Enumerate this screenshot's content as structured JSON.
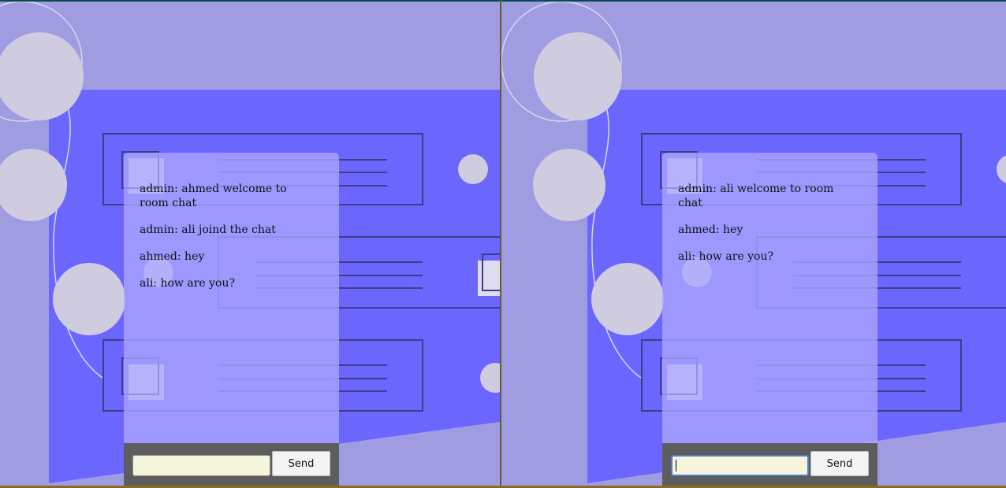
{
  "windows": [
    {
      "messages": [
        "admin: ahmed welcome to room chat",
        "admin: ali joind the chat",
        "ahmed: hey",
        "ali: how are you?"
      ],
      "input": {
        "value": "",
        "focused": false
      },
      "send_label": "Send"
    },
    {
      "messages": [
        "admin: ali welcome to room chat",
        "ahmed: hey",
        "ali: how are you?"
      ],
      "input": {
        "value": "",
        "focused": true
      },
      "send_label": "Send"
    }
  ],
  "colors": {
    "background": "#a09ce2",
    "accent_panel": "#6b66fe",
    "bubble": "#cfcce0",
    "chat_box": "#aaa6ff",
    "form_bar": "#5d5d5d",
    "input_bg": "#f5f5dc"
  }
}
